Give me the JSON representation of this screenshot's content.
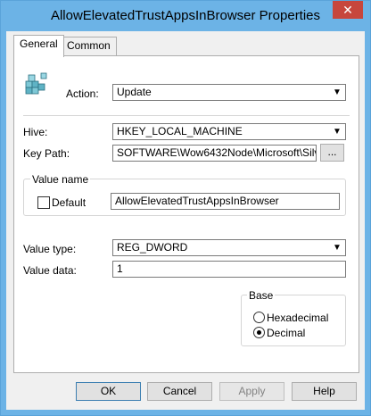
{
  "window": {
    "title": "AllowElevatedTrustAppsInBrowser Properties",
    "close_glyph": "✕"
  },
  "tabs": [
    {
      "label": "General",
      "active": true
    },
    {
      "label": "Common",
      "active": false
    }
  ],
  "form": {
    "action_label": "Action:",
    "action_value": "Update",
    "hive_label": "Hive:",
    "hive_value": "HKEY_LOCAL_MACHINE",
    "keypath_label": "Key Path:",
    "keypath_value": "SOFTWARE\\Wow6432Node\\Microsoft\\Silverlig",
    "browse_label": "...",
    "value_name_group": "Value name",
    "default_label": "Default",
    "value_name": "AllowElevatedTrustAppsInBrowser",
    "value_type_label": "Value type:",
    "value_type": "REG_DWORD",
    "value_data_label": "Value data:",
    "value_data": "1",
    "base_group": "Base",
    "hex_label": "Hexadecimal",
    "decimal_label": "Decimal"
  },
  "buttons": {
    "ok": "OK",
    "cancel": "Cancel",
    "apply": "Apply",
    "help": "Help"
  },
  "colors": {
    "titlebar": "#6cb3e6",
    "close": "#c7463d"
  }
}
